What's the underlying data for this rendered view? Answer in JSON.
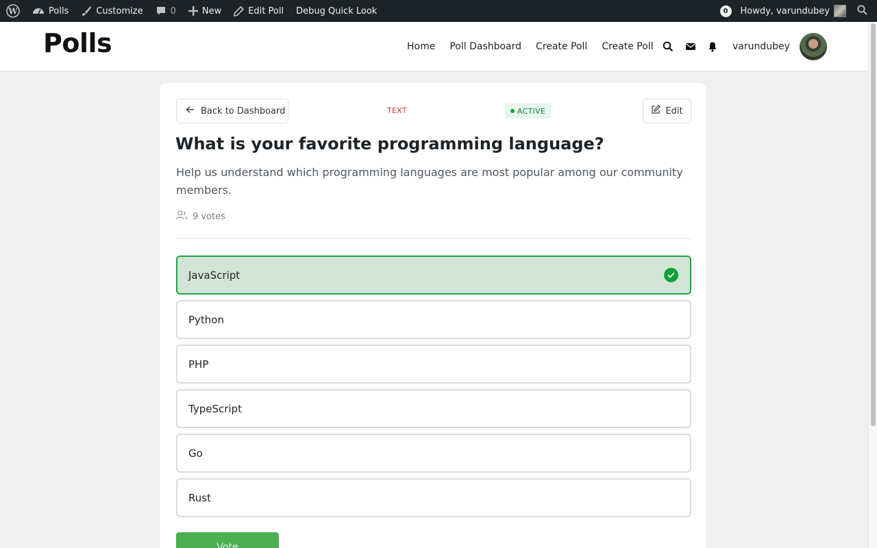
{
  "adminbar": {
    "site": "Polls",
    "customize": "Customize",
    "comments_count": "0",
    "new": "New",
    "edit": "Edit Poll",
    "debug": "Debug Quick Look",
    "notif_count": "0",
    "howdy": "Howdy, varundubey"
  },
  "header": {
    "logo": "Polls",
    "nav": [
      "Home",
      "Poll Dashboard",
      "Create Poll",
      "Create Poll"
    ],
    "username": "varundubey"
  },
  "poll": {
    "back_label": "Back to Dashboard",
    "type": "TEXT",
    "status": "ACTIVE",
    "edit_label": "Edit",
    "title": "What is your favorite programming language?",
    "description": "Help us understand which programming languages are most popular among our community members.",
    "votes": "9 votes",
    "options": [
      {
        "label": "JavaScript",
        "selected": true
      },
      {
        "label": "Python",
        "selected": false
      },
      {
        "label": "PHP",
        "selected": false
      },
      {
        "label": "TypeScript",
        "selected": false
      },
      {
        "label": "Go",
        "selected": false
      },
      {
        "label": "Rust",
        "selected": false
      }
    ],
    "vote_label": "Vote"
  },
  "colors": {
    "accent": "#4caf50",
    "selected_bg": "#d2e4d6",
    "selected_border": "#1fa34a",
    "status_green": "#1a7f37",
    "type_red": "#d63638",
    "adminbar": "#1d2327"
  }
}
